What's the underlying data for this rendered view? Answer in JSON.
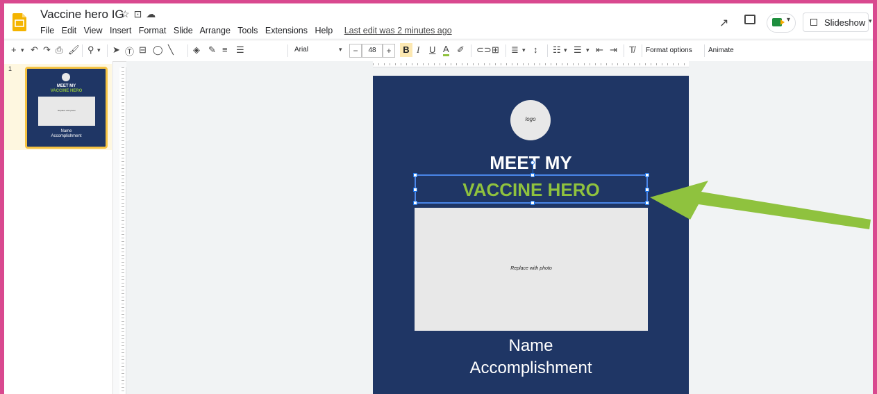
{
  "app": {
    "title": "Vaccine hero IG",
    "last_edit": "Last edit was 2 minutes ago"
  },
  "menu": [
    "File",
    "Edit",
    "View",
    "Insert",
    "Format",
    "Slide",
    "Arrange",
    "Tools",
    "Extensions",
    "Help"
  ],
  "header": {
    "slideshow_label": "Slideshow"
  },
  "toolbar": {
    "font_name": "Arial",
    "font_size": "48",
    "bold_label": "B",
    "format_options_label": "Format options",
    "animate_label": "Animate"
  },
  "filmstrip": {
    "slide_number": "1",
    "thumb_logo": "logo",
    "thumb_meet": "MEET MY",
    "thumb_hero": "VACCINE HERO",
    "thumb_photo": "Replace with photo",
    "thumb_name": "Name",
    "thumb_accomplishment": "Accomplishment"
  },
  "slide": {
    "logo_text": "logo",
    "meet_text": "MEET MY",
    "hero_text": "VACCINE HERO",
    "photo_text": "Replace with photo",
    "name_text": "Name",
    "accomplishment_text": "Accomplishment"
  },
  "colors": {
    "slide_background": "#1f3665",
    "hero_green": "#8fc23e",
    "selection_blue": "#4a86e8",
    "frame_pink": "#d9498f"
  },
  "icons": [
    "star-icon",
    "move-to-folder-icon",
    "cloud-status-icon",
    "trending-icon",
    "comment-icon",
    "meet-icon",
    "present-icon"
  ]
}
